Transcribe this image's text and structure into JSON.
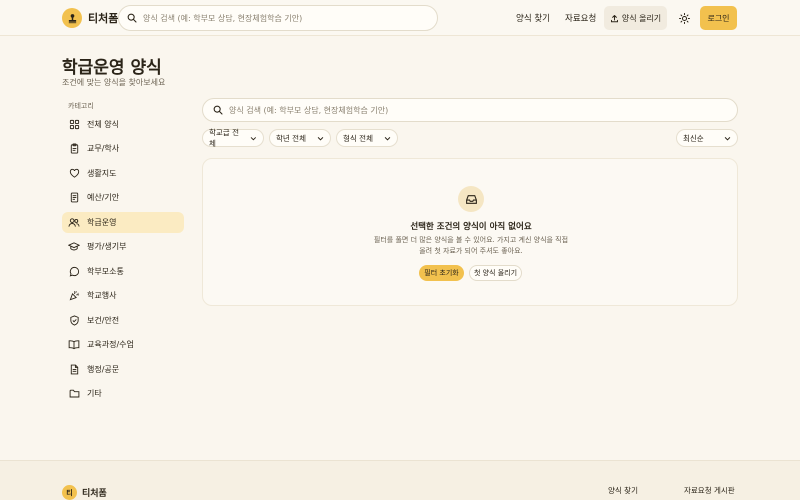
{
  "header": {
    "brand": "티처폼",
    "search_placeholder": "양식 검색 (예: 학부모 상담, 현장체험학습 기안)",
    "nav_find": "양식 찾기",
    "nav_request": "자료요청",
    "upload_label": "양식 올리기",
    "login_label": "로그인"
  },
  "page": {
    "title": "학급운영 양식",
    "subtitle": "조건에 맞는 양식을 찾아보세요"
  },
  "sidebar": {
    "category_label": "카테고리",
    "items": [
      {
        "label": "전체 양식",
        "icon": "grid-icon"
      },
      {
        "label": "교무/학사",
        "icon": "clipboard-icon"
      },
      {
        "label": "생활지도",
        "icon": "heart-hand-icon"
      },
      {
        "label": "예산/기안",
        "icon": "receipt-icon"
      },
      {
        "label": "학급운영",
        "icon": "users-icon"
      },
      {
        "label": "평가/생기부",
        "icon": "graduation-cap-icon"
      },
      {
        "label": "학부모소통",
        "icon": "chat-bubble-icon"
      },
      {
        "label": "학교행사",
        "icon": "party-popper-icon"
      },
      {
        "label": "보건/안전",
        "icon": "shield-icon"
      },
      {
        "label": "교육과정/수업",
        "icon": "book-icon"
      },
      {
        "label": "행정/공문",
        "icon": "document-icon"
      },
      {
        "label": "기타",
        "icon": "folder-icon"
      }
    ],
    "active_index": 4
  },
  "main": {
    "search_placeholder": "양식 검색 (예: 학부모 상담, 현장체험학습 기안)",
    "filters": [
      "학교급 전체",
      "학년 전체",
      "형식 전체"
    ],
    "sort": "최신순",
    "empty": {
      "title": "선택한 조건의 양식이 아직 없어요",
      "desc_line1": "필터를 풀면 더 많은 양식을 볼 수 있어요. 가지고 계신 양식을 직접",
      "desc_line2": "올려 첫 자료가 되어 주셔도 좋아요.",
      "reset_label": "필터 초기화",
      "first_upload_label": "첫 양식 올리기"
    }
  },
  "footer": {
    "logo_letter": "티",
    "brand": "티처폼",
    "link_find": "양식 찾기",
    "link_board": "자료요청 게시판"
  },
  "colors": {
    "accent": "#f2c14e",
    "background": "#faf6ee",
    "active_item": "#fbebc2"
  }
}
